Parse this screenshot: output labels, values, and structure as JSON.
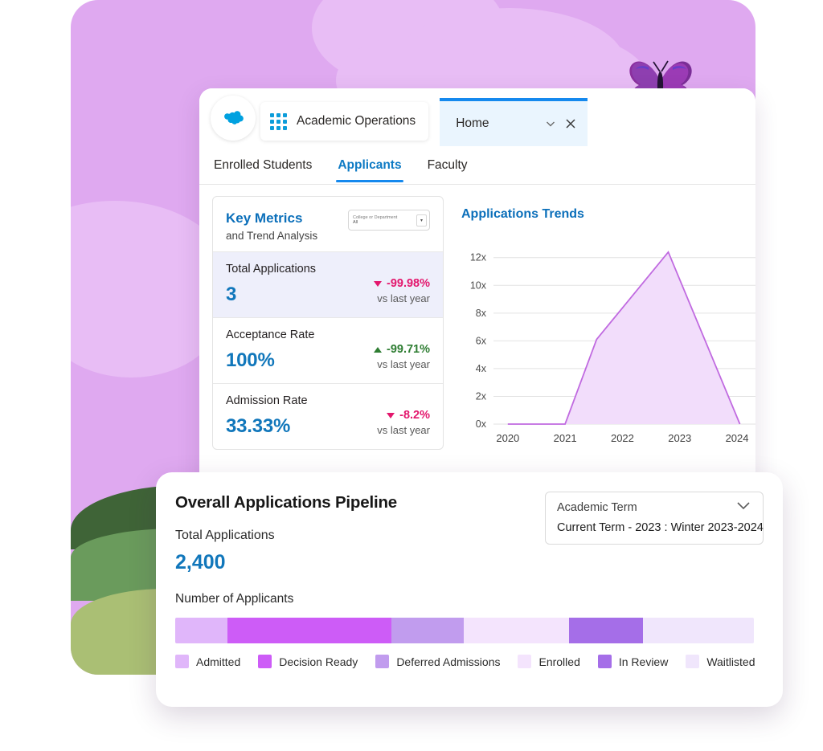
{
  "window": {
    "logo_icon": "salesforce-cloud-icon",
    "waffle_icon": "app-launcher-icon",
    "app_name": "Academic Operations",
    "tab": {
      "label": "Home",
      "dropdown_icon": "chevron-down-icon",
      "close_icon": "close-icon"
    },
    "subtabs": [
      {
        "label": "Enrolled Students",
        "active": false
      },
      {
        "label": "Applicants",
        "active": true
      },
      {
        "label": "Faculty",
        "active": false
      }
    ]
  },
  "metrics_card": {
    "title": "Key Metrics",
    "subtitle": "and Trend Analysis",
    "filter": {
      "label": "College or Department",
      "value": "All",
      "caret_icon": "dropdown-caret-icon"
    },
    "rows": [
      {
        "name": "Total Applications",
        "value": "3",
        "delta": "-99.98%",
        "direction": "down",
        "note": "vs last year",
        "highlight": true
      },
      {
        "name": "Acceptance Rate",
        "value": "100%",
        "delta": "-99.71%",
        "direction": "up",
        "note": "vs last year",
        "highlight": false
      },
      {
        "name": "Admission Rate",
        "value": "33.33%",
        "delta": "-8.2%",
        "direction": "down",
        "note": "vs last year",
        "highlight": false
      }
    ]
  },
  "chart_data": {
    "type": "area",
    "title": "Applications Trends",
    "xlabel": "",
    "ylabel": "",
    "x": [
      2020,
      2021,
      2021.55,
      2022.8,
      2024.05
    ],
    "values": [
      0,
      0,
      6.1,
      12.4,
      0
    ],
    "categories": [
      "2020",
      "2021",
      "2022",
      "2023",
      "2024"
    ],
    "xtick_labels": [
      "2020",
      "2021",
      "2022",
      "2023",
      "2024"
    ],
    "ytick_labels": [
      "0x",
      "2x",
      "4x",
      "6x",
      "8x",
      "10x",
      "12x"
    ],
    "yticks": [
      0,
      2,
      4,
      6,
      8,
      10,
      12
    ],
    "ylim": [
      0,
      13.2
    ],
    "xlim": [
      2019.75,
      2024.35
    ],
    "grid": true,
    "legend": "none",
    "line_color": "#c06ae0",
    "fill_color": "#f2ddfb"
  },
  "pipeline": {
    "title": "Overall Applications Pipeline",
    "total_label": "Total Applications",
    "total_value": "2,400",
    "bar_caption": "Number of Applicants",
    "term_filter": {
      "label": "Academic Term",
      "value": "Current Term - 2023 : Winter 2023-2024",
      "caret_icon": "chevron-down-icon"
    },
    "segments": [
      {
        "label": "Admitted",
        "color": "#e0b6fa",
        "width_pct": 9.0
      },
      {
        "label": "Decision Ready",
        "color": "#cd5cf7",
        "width_pct": 28.3
      },
      {
        "label": "Deferred Admissions",
        "color": "#c19cee",
        "width_pct": 12.5
      },
      {
        "label": "Enrolled",
        "color": "#f4e4fd",
        "width_pct": 18.2
      },
      {
        "label": "In Review",
        "color": "#a56ee8",
        "width_pct": 12.8
      },
      {
        "label": "Waitlisted",
        "color": "#f0e6fc",
        "width_pct": 19.2
      }
    ]
  }
}
